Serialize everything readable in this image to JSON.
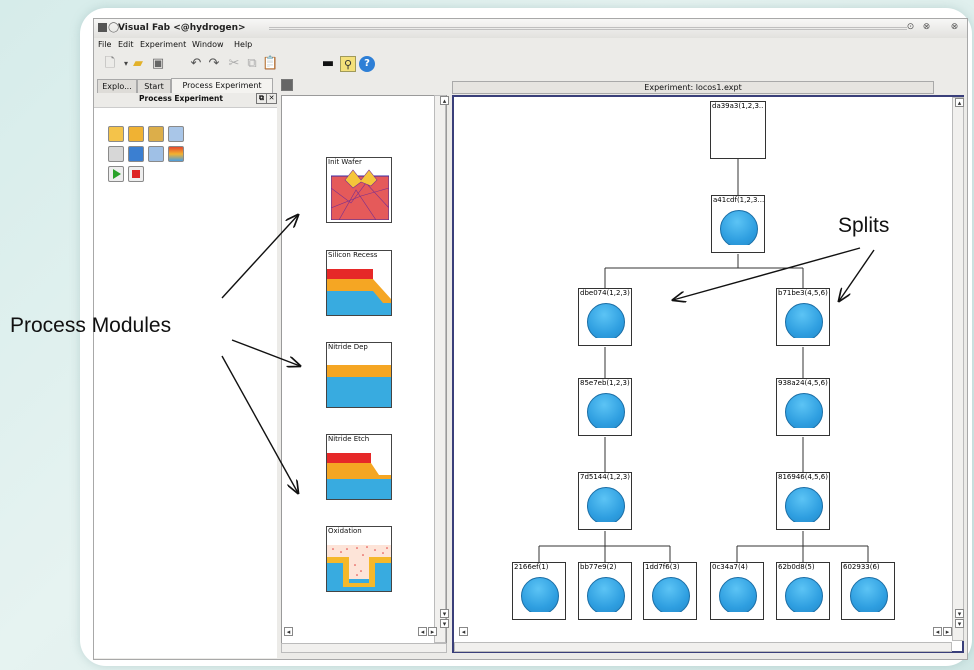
{
  "window": {
    "title": "Visual Fab <@hydrogen>"
  },
  "menu": [
    "File",
    "Edit",
    "Experiment",
    "Window",
    "Help"
  ],
  "tabs": {
    "explorer": "Explo...",
    "start": "Start",
    "process_experiment": "Process Experiment"
  },
  "dock_title": "Process Experiment",
  "experiment_tab": "Experiment: locos1.expt",
  "modules": [
    {
      "label": "Init Wafer"
    },
    {
      "label": "Silicon Recess"
    },
    {
      "label": "Nitride Dep"
    },
    {
      "label": "Nitride Etch"
    },
    {
      "label": "Oxidation"
    }
  ],
  "nodes": {
    "root": "da39a3(1,2,3...",
    "n1": "a41cdf(1,2,3...",
    "left_split": "dbe074(1,2,3)",
    "right_split": "b71be3(4,5,6)",
    "left_2": "85e7eb(1,2,3)",
    "right_2": "938a24(4,5,6)",
    "left_3": "7d5144(1,2,3)",
    "right_3": "816946(4,5,6)",
    "leaves": [
      "2166ef(1)",
      "bb77e9(2)",
      "1dd7f6(3)",
      "0c34a7(4)",
      "62b0d8(5)",
      "602933(6)"
    ]
  },
  "annotations": {
    "process_modules": "Process Modules",
    "splits": "Splits"
  },
  "colors": {
    "dome_blue": "#2e9ee0",
    "nitride_red": "#e02828",
    "oxide_orange": "#f5a623",
    "silicon_blue": "#38abe0"
  }
}
